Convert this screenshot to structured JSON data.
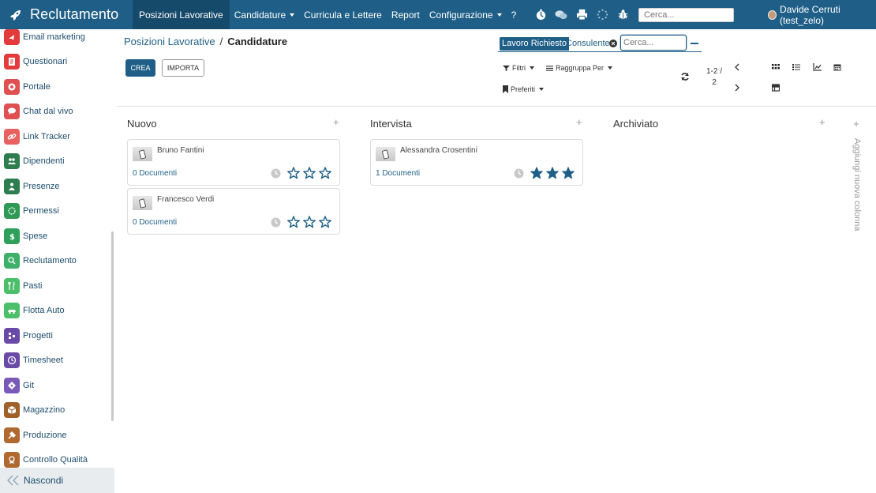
{
  "app": {
    "name": "Reclutamento"
  },
  "nav": {
    "menus": [
      {
        "label": "Posizioni Lavorative",
        "active": true,
        "dropdown": false
      },
      {
        "label": "Candidature",
        "active": false,
        "dropdown": true
      },
      {
        "label": "Curricula e Lettere",
        "active": false,
        "dropdown": false
      },
      {
        "label": "Report",
        "active": false,
        "dropdown": false
      },
      {
        "label": "Configurazione",
        "active": false,
        "dropdown": true
      },
      {
        "label": "?",
        "active": false,
        "dropdown": false
      }
    ],
    "icons": [
      "activity-icon",
      "chat-icon",
      "print-icon",
      "loading-icon",
      "bug-icon"
    ],
    "search_placeholder": "Cerca...",
    "user": "Davide Cerruti (test_zelo)"
  },
  "sidebar": {
    "items": [
      {
        "label": "Email marketing",
        "icon": "email-marketing-icon",
        "color": "#e33b3b"
      },
      {
        "label": "Questionari",
        "icon": "survey-icon",
        "color": "#e33b3b"
      },
      {
        "label": "Portale",
        "icon": "portal-icon",
        "color": "#e05050"
      },
      {
        "label": "Chat dal vivo",
        "icon": "live-chat-icon",
        "color": "#e05050"
      },
      {
        "label": "Link Tracker",
        "icon": "link-tracker-icon",
        "color": "#e86060"
      },
      {
        "label": "Dipendenti",
        "icon": "employees-icon",
        "color": "#2e7d4f"
      },
      {
        "label": "Presenze",
        "icon": "attendance-icon",
        "color": "#2e7d4f"
      },
      {
        "label": "Permessi",
        "icon": "leave-icon",
        "color": "#2e9a55"
      },
      {
        "label": "Spese",
        "icon": "expenses-icon",
        "color": "#2ea05a"
      },
      {
        "label": "Reclutamento",
        "icon": "recruitment-icon",
        "color": "#3fb06a"
      },
      {
        "label": "Pasti",
        "icon": "lunch-icon",
        "color": "#4cbf6a"
      },
      {
        "label": "Flotta Auto",
        "icon": "fleet-icon",
        "color": "#4cbf6a"
      },
      {
        "label": "Progetti",
        "icon": "project-icon",
        "color": "#6a4aa8"
      },
      {
        "label": "Timesheet",
        "icon": "timesheet-icon",
        "color": "#6a4aa8"
      },
      {
        "label": "Git",
        "icon": "git-icon",
        "color": "#7a5ab8"
      },
      {
        "label": "Magazzino",
        "icon": "inventory-icon",
        "color": "#a0602a"
      },
      {
        "label": "Produzione",
        "icon": "manufacturing-icon",
        "color": "#b06a30"
      },
      {
        "label": "Controllo Qualità",
        "icon": "quality-icon",
        "color": "#b06a30"
      }
    ],
    "hide_label": "Nascondi"
  },
  "breadcrumb": {
    "parent": "Posizioni Lavorative",
    "separator": "/",
    "current": "Candidature"
  },
  "buttons": {
    "create": "CREA",
    "import": "IMPORTA"
  },
  "search": {
    "facet_label": "Lavoro Richiesto",
    "facet_value": "Consulente",
    "placeholder": "Cerca..."
  },
  "filters": {
    "filters": "Filtri",
    "group_by": "Raggruppa Per",
    "favorites": "Preferiti"
  },
  "pager": {
    "range": "1-2 /",
    "total": "2"
  },
  "views": [
    "kanban-view-icon",
    "list-view-icon",
    "graph-view-icon",
    "calendar-view-icon",
    "pivot-view-icon"
  ],
  "kanban": {
    "columns": [
      {
        "title": "Nuovo",
        "cards": [
          {
            "name": "Bruno Fantini",
            "documents": "0 Documenti",
            "priority": 0
          },
          {
            "name": "Francesco Verdi",
            "documents": "0 Documenti",
            "priority": 0
          }
        ]
      },
      {
        "title": "Intervista",
        "cards": [
          {
            "name": "Alessandra Crosentini",
            "documents": "1 Documenti",
            "priority": 3
          }
        ]
      },
      {
        "title": "Archiviato",
        "cards": []
      }
    ],
    "add_column_label": "Aggiungi nuova colonna"
  },
  "colors": {
    "primary": "#1f5f87",
    "navbar": "#1f5f87",
    "star": "#1f5f87"
  }
}
